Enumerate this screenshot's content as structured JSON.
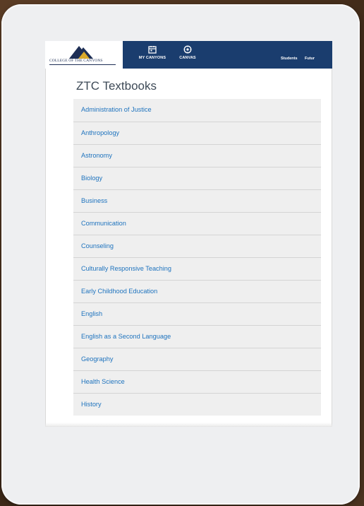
{
  "header": {
    "logo_text": "COLLEGE OF THE CANYONS",
    "nav_buttons": [
      {
        "label": "MY CANYONS",
        "icon": "calendar-icon"
      },
      {
        "label": "CANVAS",
        "icon": "canvas-icon"
      }
    ],
    "nav_links": [
      "Students",
      "Futur"
    ]
  },
  "page": {
    "title": "ZTC Textbooks"
  },
  "subjects": [
    "Administration of Justice",
    "Anthropology",
    "Astronomy",
    "Biology",
    "Business",
    "Communication",
    "Counseling",
    "Culturally Responsive Teaching",
    "Early Childhood Education",
    "English",
    "English as a Second Language",
    "Geography",
    "Health Science",
    "History"
  ],
  "colors": {
    "nav_background": "#1a3d6e",
    "link": "#1e73be",
    "list_background": "#efefef",
    "logo_gold": "#d9a92b"
  }
}
